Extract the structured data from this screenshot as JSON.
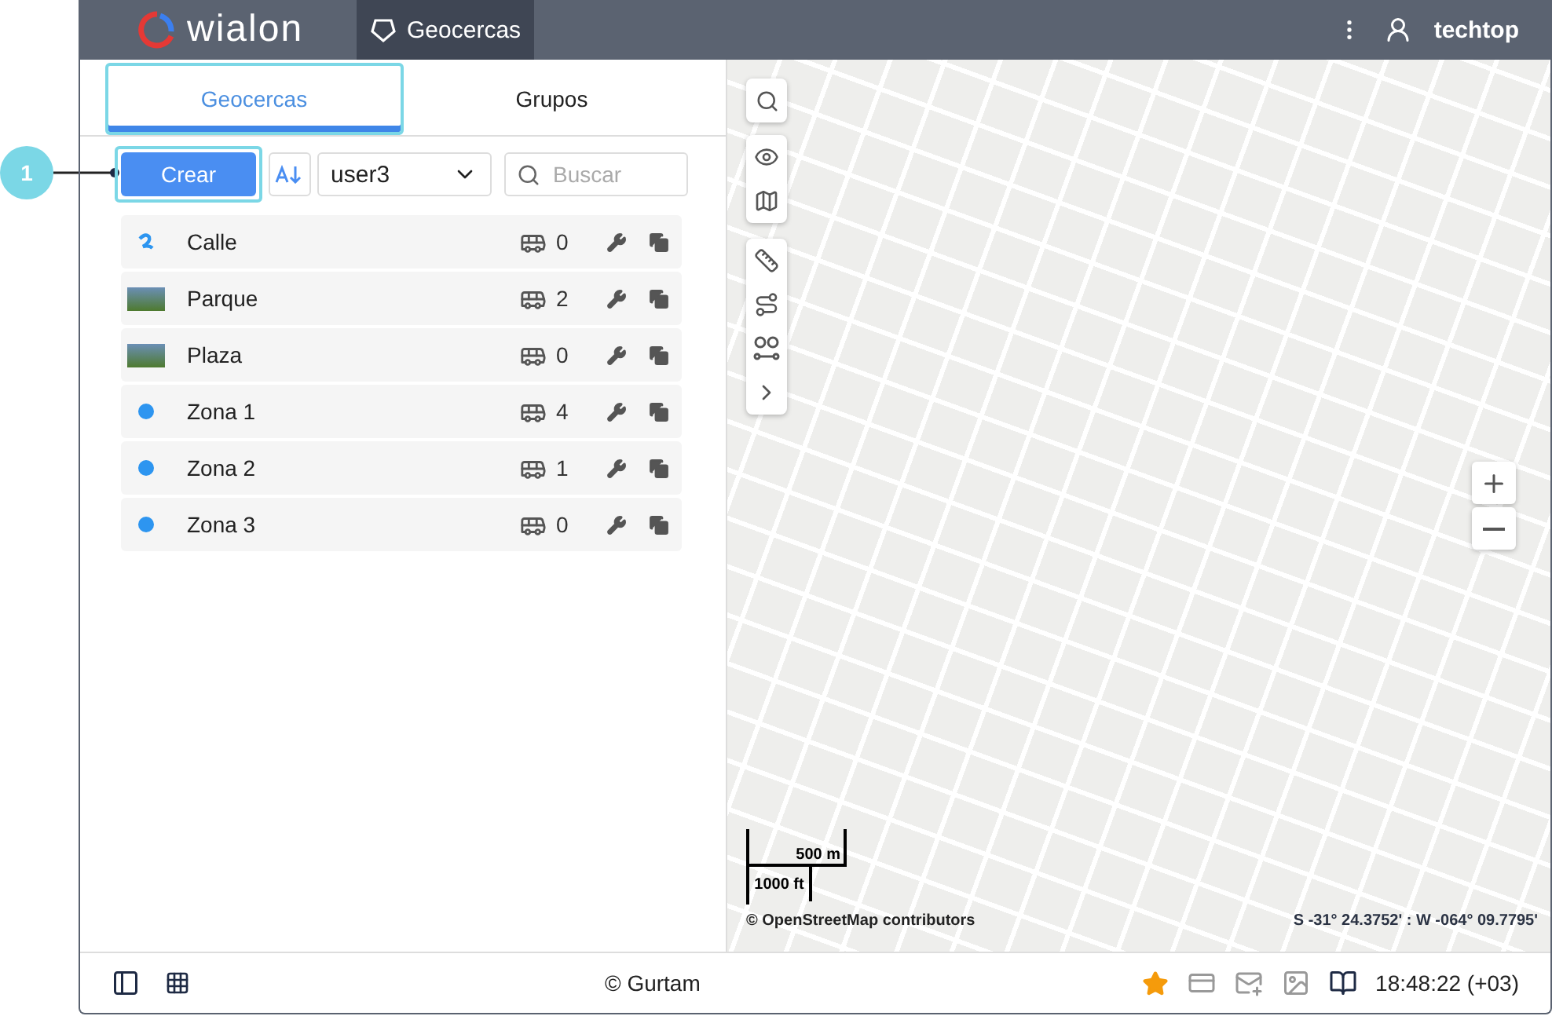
{
  "callout": {
    "label": "1"
  },
  "header": {
    "logo": "wialon",
    "app_tab": "Geocercas",
    "user": "techtop"
  },
  "tabs": [
    {
      "label": "Geocercas",
      "selected": true
    },
    {
      "label": "Grupos",
      "selected": false
    }
  ],
  "toolbar": {
    "create_button": "Crear",
    "user_select": "user3",
    "search": {
      "placeholder": "Buscar"
    }
  },
  "geofences": [
    {
      "name": "Calle",
      "kind": "line",
      "units": "0"
    },
    {
      "name": "Parque",
      "kind": "photo",
      "units": "2"
    },
    {
      "name": "Plaza",
      "kind": "photo",
      "units": "0"
    },
    {
      "name": "Zona 1",
      "kind": "circle",
      "units": "4"
    },
    {
      "name": "Zona 2",
      "kind": "circle",
      "units": "1"
    },
    {
      "name": "Zona 3",
      "kind": "circle",
      "units": "0"
    }
  ],
  "map": {
    "scale_metric": "500 m",
    "scale_imperial": "1000 ft",
    "attribution": "© OpenStreetMap contributors",
    "coordinates": "S -31° 24.3752' : W -064° 09.7795'"
  },
  "footer": {
    "copyright": "© Gurtam",
    "time": "18:48:22 (+03)"
  }
}
